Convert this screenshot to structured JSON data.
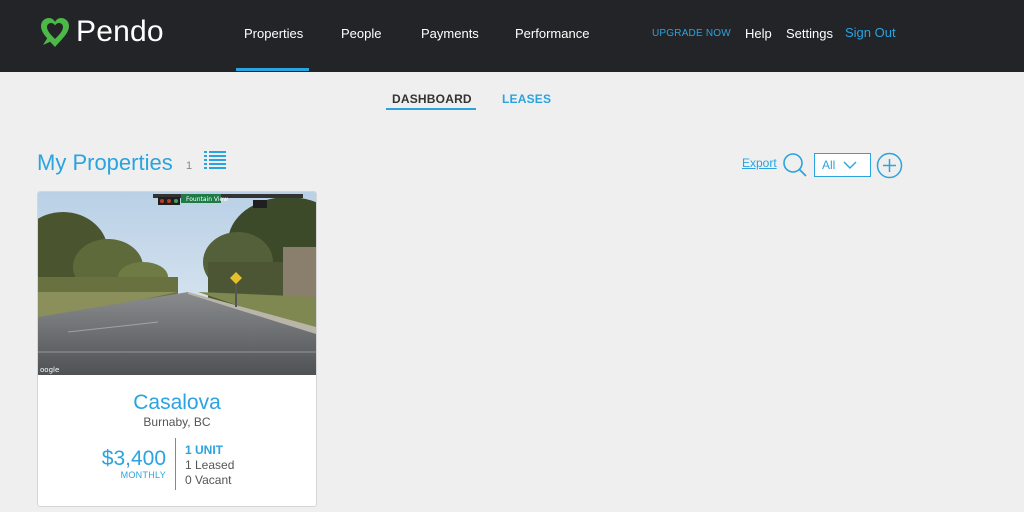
{
  "app": {
    "name": "Pendo"
  },
  "nav": {
    "items": [
      {
        "label": "Properties",
        "active": true
      },
      {
        "label": "People"
      },
      {
        "label": "Payments"
      },
      {
        "label": "Performance"
      }
    ],
    "upgrade": "UPGRADE NOW",
    "help": "Help",
    "settings": "Settings",
    "signout": "Sign Out"
  },
  "subnav": {
    "tabs": [
      {
        "label": "DASHBOARD",
        "active": true
      },
      {
        "label": "LEASES"
      }
    ]
  },
  "section": {
    "title": "My Properties",
    "count": "1",
    "export": "Export",
    "filter_value": "All"
  },
  "properties": [
    {
      "name": "Casalova",
      "location": "Burnaby, BC",
      "rent": "$3,400",
      "rent_period": "MONTHLY",
      "units": "1 UNIT",
      "leased": "1 Leased",
      "vacant": "0 Vacant",
      "street_sign": "Fountain View",
      "photo_watermark": "oogle"
    }
  ],
  "colors": {
    "accent": "#2aa3df",
    "topbar": "#232428",
    "logo_green": "#4cb848",
    "background": "#efefef"
  },
  "icons": [
    "pendo-logo-icon",
    "list-view-icon",
    "search-icon",
    "chevron-down-icon",
    "add-icon"
  ]
}
